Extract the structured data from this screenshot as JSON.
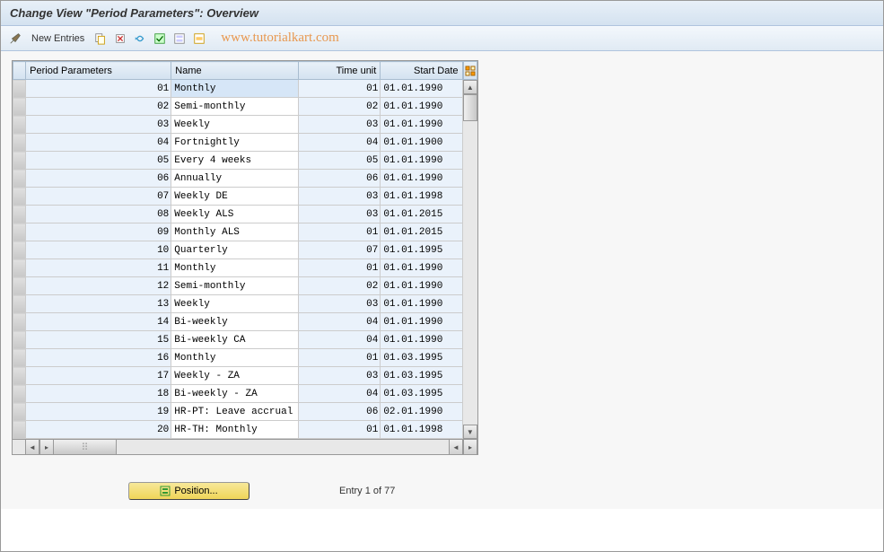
{
  "title": "Change View \"Period Parameters\": Overview",
  "toolbar": {
    "new_entries": "New Entries"
  },
  "watermark": "www.tutorialkart.com",
  "columns": {
    "period_params": "Period Parameters",
    "name": "Name",
    "time_unit": "Time unit",
    "start_date": "Start Date"
  },
  "rows": [
    {
      "pp": "01",
      "name": "Monthly",
      "tu": "01",
      "sd": "01.01.1990",
      "sel": true
    },
    {
      "pp": "02",
      "name": "Semi-monthly",
      "tu": "02",
      "sd": "01.01.1990"
    },
    {
      "pp": "03",
      "name": "Weekly",
      "tu": "03",
      "sd": "01.01.1990"
    },
    {
      "pp": "04",
      "name": "Fortnightly",
      "tu": "04",
      "sd": "01.01.1900"
    },
    {
      "pp": "05",
      "name": "Every 4 weeks",
      "tu": "05",
      "sd": "01.01.1990"
    },
    {
      "pp": "06",
      "name": "Annually",
      "tu": "06",
      "sd": "01.01.1990"
    },
    {
      "pp": "07",
      "name": "Weekly  DE",
      "tu": "03",
      "sd": "01.01.1998"
    },
    {
      "pp": "08",
      "name": "Weekly ALS",
      "tu": "03",
      "sd": "01.01.2015"
    },
    {
      "pp": "09",
      "name": "Monthly ALS",
      "tu": "01",
      "sd": "01.01.2015"
    },
    {
      "pp": "10",
      "name": "Quarterly",
      "tu": "07",
      "sd": "01.01.1995"
    },
    {
      "pp": "11",
      "name": "Monthly",
      "tu": "01",
      "sd": "01.01.1990"
    },
    {
      "pp": "12",
      "name": "Semi-monthly",
      "tu": "02",
      "sd": "01.01.1990"
    },
    {
      "pp": "13",
      "name": "Weekly",
      "tu": "03",
      "sd": "01.01.1990"
    },
    {
      "pp": "14",
      "name": "Bi-weekly",
      "tu": "04",
      "sd": "01.01.1990"
    },
    {
      "pp": "15",
      "name": "Bi-weekly CA",
      "tu": "04",
      "sd": "01.01.1990"
    },
    {
      "pp": "16",
      "name": "Monthly",
      "tu": "01",
      "sd": "01.03.1995"
    },
    {
      "pp": "17",
      "name": "Weekly - ZA",
      "tu": "03",
      "sd": "01.03.1995"
    },
    {
      "pp": "18",
      "name": "Bi-weekly - ZA",
      "tu": "04",
      "sd": "01.03.1995"
    },
    {
      "pp": "19",
      "name": "HR-PT: Leave accrual",
      "tu": "06",
      "sd": "02.01.1990"
    },
    {
      "pp": "20",
      "name": "HR-TH: Monthly",
      "tu": "01",
      "sd": "01.01.1998"
    }
  ],
  "position_btn": "Position...",
  "entry_info": "Entry 1 of 77"
}
